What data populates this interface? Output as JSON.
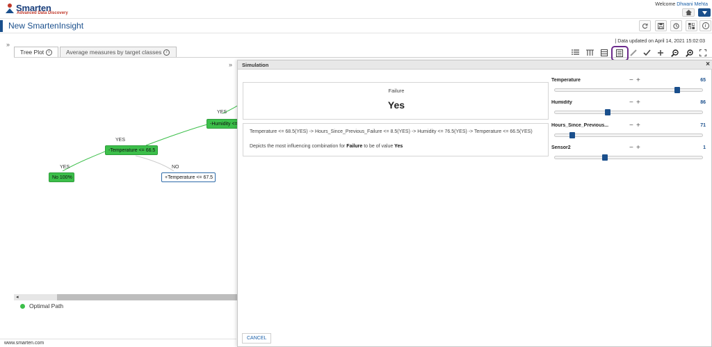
{
  "app": {
    "logo_name": "Smarten",
    "logo_tagline": "Advanced Data Discovery",
    "welcome_prefix": "Welcome ",
    "user_name": "Dhwani Mehta",
    "page_title": "New SmartenInsight",
    "data_updated": "|  Data updated on April 14, 2021 15:02:03",
    "footer": "www.smarten.com"
  },
  "tabs": [
    {
      "label": "Tree Plot"
    },
    {
      "label": "Average measures by target classes"
    }
  ],
  "tree": {
    "nodes": [
      {
        "label": "-Humidity <="
      },
      {
        "label": "-Temperature <= 66.5"
      },
      {
        "label": "No 100%"
      },
      {
        "label": "+Temperature <= 67.5"
      }
    ],
    "edges": [
      "YES",
      "YES",
      "YES",
      "NO"
    ]
  },
  "legend": {
    "optimal_path": "Optimal Path"
  },
  "simulation": {
    "title": "Simulation",
    "target_name": "Failure",
    "predicted_value": "Yes",
    "path": "Temperature <= 68.5(YES) -> Hours_Since_Previous_Failure <= 8.5(YES) -> Humidity <= 76.5(YES) -> Temperature <= 66.5(YES)",
    "desc_prefix": "Depicts the most influencing combination for ",
    "desc_target": "Failure",
    "desc_middle": " to be of value ",
    "desc_value": "Yes",
    "cancel_label": "CANCEL",
    "minus_glyph": "−",
    "plus_glyph": "+",
    "close_glyph": "×",
    "sliders": [
      {
        "label": "Temperature",
        "value": "65",
        "fraction": 0.83
      },
      {
        "label": "Humidity",
        "value": "86",
        "fraction": 0.36
      },
      {
        "label": "Hours_Since_Previous...",
        "value": "71",
        "fraction": 0.12
      },
      {
        "label": "Sensor2",
        "value": "1",
        "fraction": 0.34
      }
    ]
  },
  "icons": {
    "colors": {
      "brand": "#1a4f8c",
      "highlight": "#6c2a8c",
      "node_green": "#3cbf4a"
    }
  }
}
